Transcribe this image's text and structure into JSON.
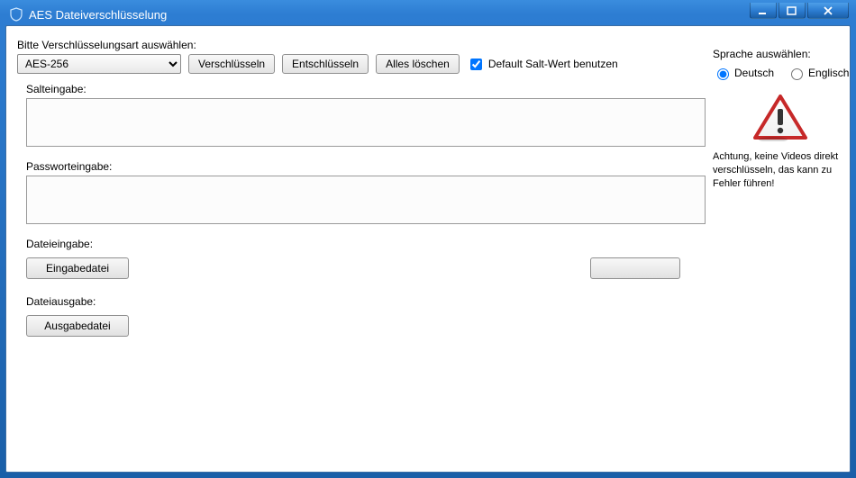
{
  "window": {
    "title": "AES Dateiverschlüsselung"
  },
  "top": {
    "prompt": "Bitte Verschlüsselungsart auswählen:",
    "selected_algo": "AES-256",
    "encrypt_btn": "Verschlüsseln",
    "decrypt_btn": "Entschlüsseln",
    "clear_btn": "Alles löschen",
    "default_salt_label": "Default Salt-Wert benutzen",
    "default_salt_checked": true
  },
  "salt": {
    "label": "Salteingabe:",
    "value": ""
  },
  "password": {
    "label": "Passworteingabe:",
    "value": ""
  },
  "file_in": {
    "label": "Dateieingabe:",
    "button": "Eingabedatei",
    "progress_button": ""
  },
  "file_out": {
    "label": "Dateiausgabe:",
    "button": "Ausgabedatei"
  },
  "side": {
    "lang_label": "Sprache auswählen:",
    "lang_de": "Deutsch",
    "lang_en": "Englisch",
    "lang_selected": "de",
    "warning": "Achtung, keine Videos direkt verschlüsseln, das kann zu Fehler führen!"
  }
}
